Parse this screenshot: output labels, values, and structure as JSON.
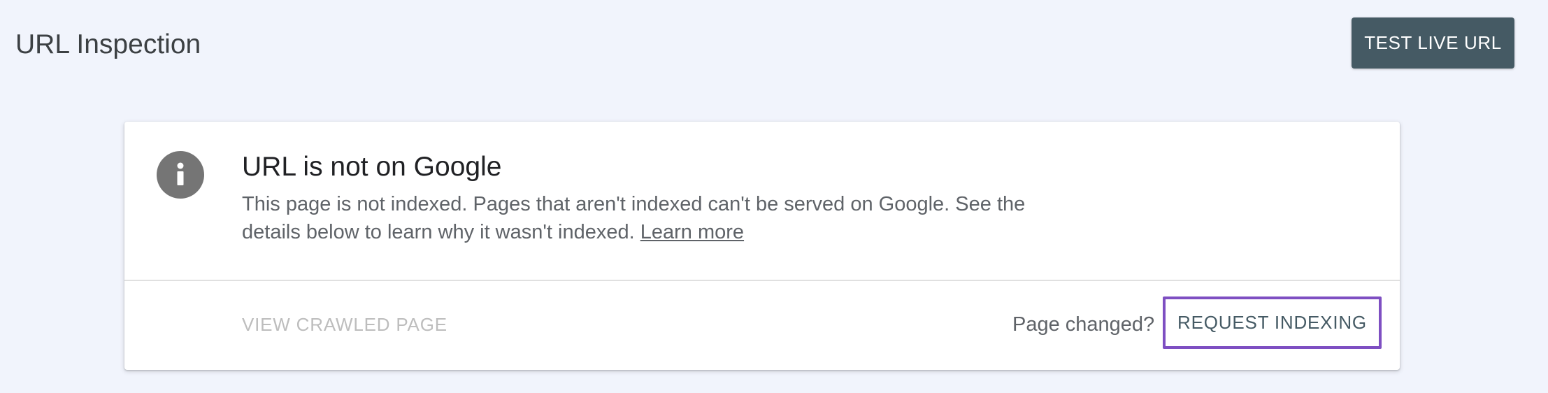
{
  "header": {
    "title": "URL Inspection",
    "test_live_url_label": "TEST LIVE URL"
  },
  "status_card": {
    "icon": "info-icon",
    "title": "URL is not on Google",
    "description": "This page is not indexed. Pages that aren't indexed can't be served on Google. See the details below to learn why it wasn't indexed.",
    "learn_more_label": "Learn more",
    "view_crawled_page_label": "VIEW CRAWLED PAGE",
    "page_changed_text": "Page changed?",
    "request_indexing_label": "REQUEST INDEXING"
  },
  "colors": {
    "background": "#f1f4fc",
    "primary_button": "#455a64",
    "highlight_outline": "#7e4fc2",
    "info_icon": "#757575"
  }
}
